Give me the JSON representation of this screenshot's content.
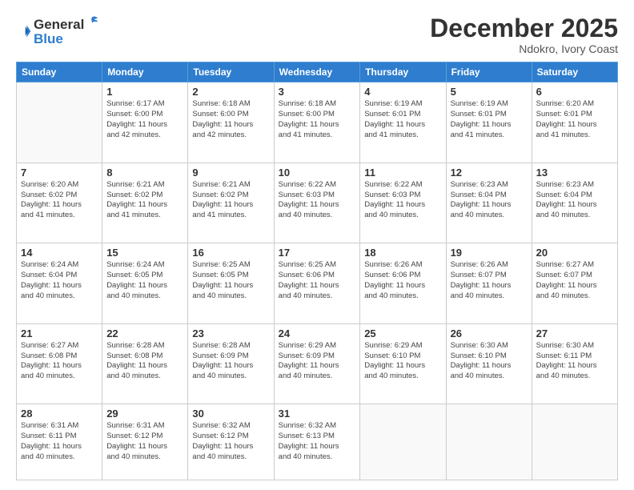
{
  "header": {
    "logo_line1": "General",
    "logo_line2": "Blue",
    "month": "December 2025",
    "location": "Ndokro, Ivory Coast"
  },
  "weekdays": [
    "Sunday",
    "Monday",
    "Tuesday",
    "Wednesday",
    "Thursday",
    "Friday",
    "Saturday"
  ],
  "weeks": [
    [
      {
        "day": "",
        "info": ""
      },
      {
        "day": "1",
        "info": "Sunrise: 6:17 AM\nSunset: 6:00 PM\nDaylight: 11 hours\nand 42 minutes."
      },
      {
        "day": "2",
        "info": "Sunrise: 6:18 AM\nSunset: 6:00 PM\nDaylight: 11 hours\nand 42 minutes."
      },
      {
        "day": "3",
        "info": "Sunrise: 6:18 AM\nSunset: 6:00 PM\nDaylight: 11 hours\nand 41 minutes."
      },
      {
        "day": "4",
        "info": "Sunrise: 6:19 AM\nSunset: 6:01 PM\nDaylight: 11 hours\nand 41 minutes."
      },
      {
        "day": "5",
        "info": "Sunrise: 6:19 AM\nSunset: 6:01 PM\nDaylight: 11 hours\nand 41 minutes."
      },
      {
        "day": "6",
        "info": "Sunrise: 6:20 AM\nSunset: 6:01 PM\nDaylight: 11 hours\nand 41 minutes."
      }
    ],
    [
      {
        "day": "7",
        "info": "Sunrise: 6:20 AM\nSunset: 6:02 PM\nDaylight: 11 hours\nand 41 minutes."
      },
      {
        "day": "8",
        "info": "Sunrise: 6:21 AM\nSunset: 6:02 PM\nDaylight: 11 hours\nand 41 minutes."
      },
      {
        "day": "9",
        "info": "Sunrise: 6:21 AM\nSunset: 6:02 PM\nDaylight: 11 hours\nand 41 minutes."
      },
      {
        "day": "10",
        "info": "Sunrise: 6:22 AM\nSunset: 6:03 PM\nDaylight: 11 hours\nand 40 minutes."
      },
      {
        "day": "11",
        "info": "Sunrise: 6:22 AM\nSunset: 6:03 PM\nDaylight: 11 hours\nand 40 minutes."
      },
      {
        "day": "12",
        "info": "Sunrise: 6:23 AM\nSunset: 6:04 PM\nDaylight: 11 hours\nand 40 minutes."
      },
      {
        "day": "13",
        "info": "Sunrise: 6:23 AM\nSunset: 6:04 PM\nDaylight: 11 hours\nand 40 minutes."
      }
    ],
    [
      {
        "day": "14",
        "info": "Sunrise: 6:24 AM\nSunset: 6:04 PM\nDaylight: 11 hours\nand 40 minutes."
      },
      {
        "day": "15",
        "info": "Sunrise: 6:24 AM\nSunset: 6:05 PM\nDaylight: 11 hours\nand 40 minutes."
      },
      {
        "day": "16",
        "info": "Sunrise: 6:25 AM\nSunset: 6:05 PM\nDaylight: 11 hours\nand 40 minutes."
      },
      {
        "day": "17",
        "info": "Sunrise: 6:25 AM\nSunset: 6:06 PM\nDaylight: 11 hours\nand 40 minutes."
      },
      {
        "day": "18",
        "info": "Sunrise: 6:26 AM\nSunset: 6:06 PM\nDaylight: 11 hours\nand 40 minutes."
      },
      {
        "day": "19",
        "info": "Sunrise: 6:26 AM\nSunset: 6:07 PM\nDaylight: 11 hours\nand 40 minutes."
      },
      {
        "day": "20",
        "info": "Sunrise: 6:27 AM\nSunset: 6:07 PM\nDaylight: 11 hours\nand 40 minutes."
      }
    ],
    [
      {
        "day": "21",
        "info": "Sunrise: 6:27 AM\nSunset: 6:08 PM\nDaylight: 11 hours\nand 40 minutes."
      },
      {
        "day": "22",
        "info": "Sunrise: 6:28 AM\nSunset: 6:08 PM\nDaylight: 11 hours\nand 40 minutes."
      },
      {
        "day": "23",
        "info": "Sunrise: 6:28 AM\nSunset: 6:09 PM\nDaylight: 11 hours\nand 40 minutes."
      },
      {
        "day": "24",
        "info": "Sunrise: 6:29 AM\nSunset: 6:09 PM\nDaylight: 11 hours\nand 40 minutes."
      },
      {
        "day": "25",
        "info": "Sunrise: 6:29 AM\nSunset: 6:10 PM\nDaylight: 11 hours\nand 40 minutes."
      },
      {
        "day": "26",
        "info": "Sunrise: 6:30 AM\nSunset: 6:10 PM\nDaylight: 11 hours\nand 40 minutes."
      },
      {
        "day": "27",
        "info": "Sunrise: 6:30 AM\nSunset: 6:11 PM\nDaylight: 11 hours\nand 40 minutes."
      }
    ],
    [
      {
        "day": "28",
        "info": "Sunrise: 6:31 AM\nSunset: 6:11 PM\nDaylight: 11 hours\nand 40 minutes."
      },
      {
        "day": "29",
        "info": "Sunrise: 6:31 AM\nSunset: 6:12 PM\nDaylight: 11 hours\nand 40 minutes."
      },
      {
        "day": "30",
        "info": "Sunrise: 6:32 AM\nSunset: 6:12 PM\nDaylight: 11 hours\nand 40 minutes."
      },
      {
        "day": "31",
        "info": "Sunrise: 6:32 AM\nSunset: 6:13 PM\nDaylight: 11 hours\nand 40 minutes."
      },
      {
        "day": "",
        "info": ""
      },
      {
        "day": "",
        "info": ""
      },
      {
        "day": "",
        "info": ""
      }
    ]
  ]
}
